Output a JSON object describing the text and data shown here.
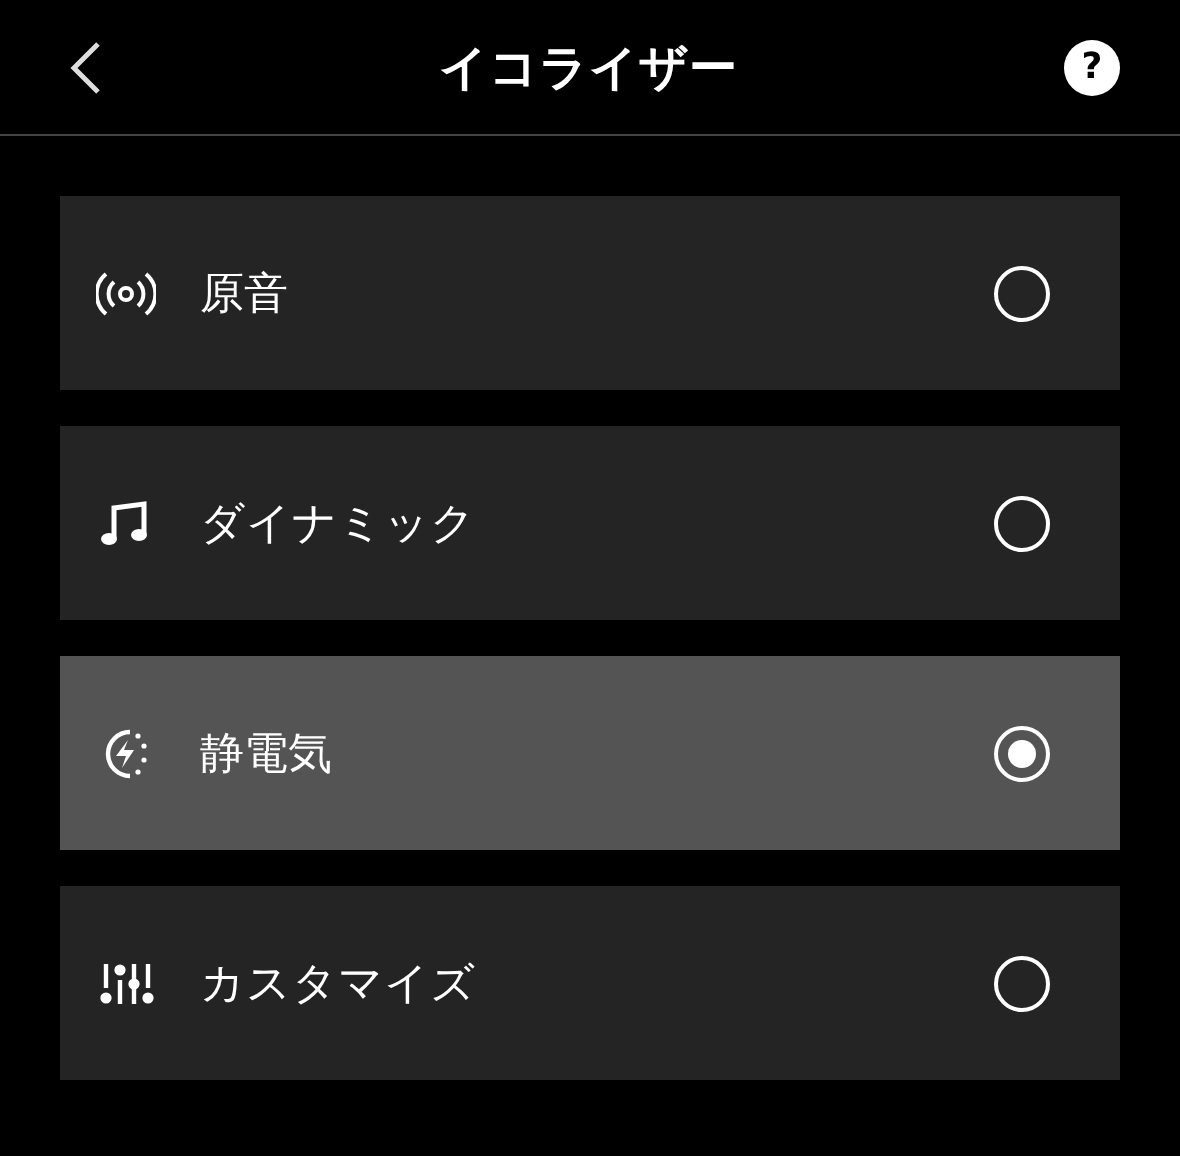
{
  "header": {
    "title": "イコライザー",
    "help": "?"
  },
  "presets": [
    {
      "kind": "broadcast",
      "label": "原音",
      "selected": false
    },
    {
      "kind": "note",
      "label": "ダイナミック",
      "selected": false
    },
    {
      "kind": "bolt",
      "label": "静電気",
      "selected": true
    },
    {
      "kind": "sliders",
      "label": "カスタマイズ",
      "selected": false
    }
  ]
}
